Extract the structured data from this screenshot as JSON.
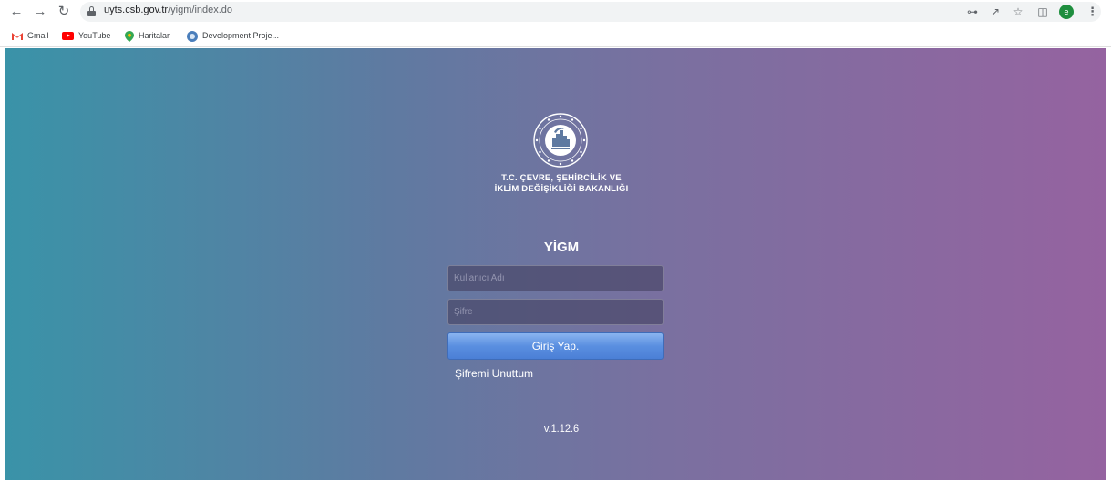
{
  "browser": {
    "url_host": "uyts.csb.gov.tr",
    "url_path": "/yigm/index.do",
    "profile_initial": "e",
    "bookmarks": [
      {
        "label": "Gmail",
        "icon": "gmail-icon"
      },
      {
        "label": "YouTube",
        "icon": "youtube-icon"
      },
      {
        "label": "Haritalar",
        "icon": "maps-icon"
      },
      {
        "label": "Development Proje...",
        "icon": "globe-icon"
      }
    ],
    "icons": [
      "back-icon",
      "forward-icon",
      "reload-icon",
      "lock-icon",
      "key-icon",
      "share-icon",
      "star-icon",
      "side-panel-icon",
      "menu-icon"
    ]
  },
  "login": {
    "ministry_line1": "T.C. ÇEVRE, ŞEHİRCİLİK VE",
    "ministry_line2": "İKLİM DEĞİŞİKLİĞİ BAKANLIĞI",
    "app_title": "YİGM",
    "username_placeholder": "Kullanıcı Adı",
    "password_placeholder": "Şifre",
    "submit_label": "Giriş Yap.",
    "forgot_label": "Şifremi Unuttum",
    "version": "v.1.12.6"
  },
  "colors": {
    "gradient_left": "#3a93a8",
    "gradient_right": "#9563a0",
    "button": "#5a8fe0"
  }
}
